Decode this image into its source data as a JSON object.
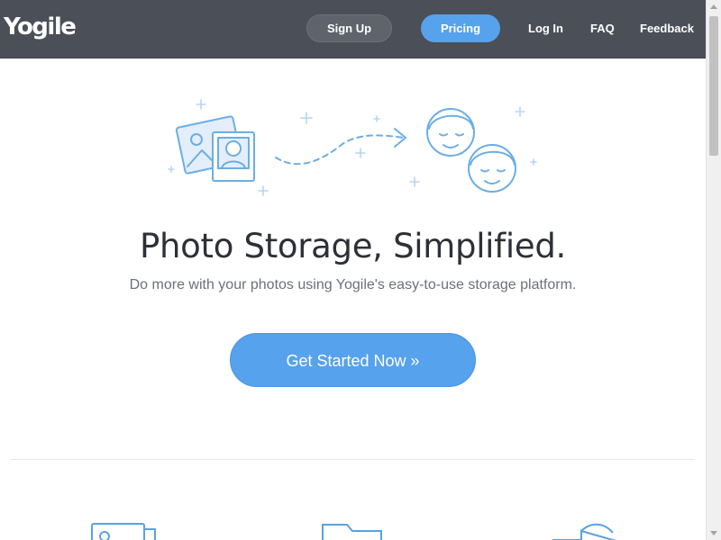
{
  "brand": {
    "logo_text": "Yogile"
  },
  "nav": {
    "signup_label": "Sign Up",
    "pricing_label": "Pricing",
    "login_label": "Log In",
    "faq_label": "FAQ",
    "feedback_label": "Feedback"
  },
  "hero": {
    "illustration_icons": [
      "photos-icon",
      "arrow-icon",
      "faces-icon",
      "sparkle-icon"
    ],
    "title": "Photo Storage, Simplified.",
    "subtitle": "Do more with your photos using Yogile's easy-to-use storage platform.",
    "cta_label": "Get Started Now »"
  },
  "features": {
    "icons": [
      "photo-album-icon",
      "folder-icon",
      "share-icon"
    ]
  },
  "colors": {
    "topbar": "#4b4f58",
    "accent_blue": "#56a2ec",
    "illustration_blue": "#5aa2e0",
    "title_text": "#2e3037",
    "muted_text": "#6c7079"
  }
}
